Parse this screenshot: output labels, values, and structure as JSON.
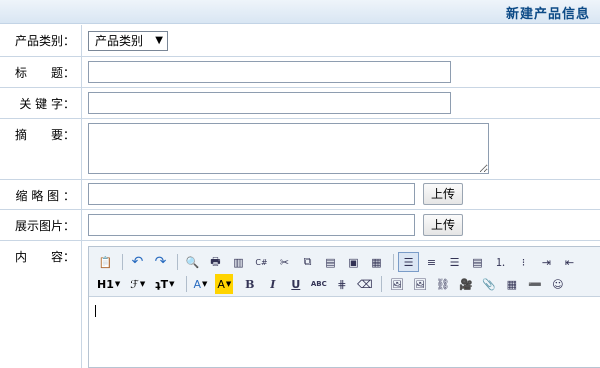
{
  "header": {
    "title": "新建产品信息"
  },
  "form": {
    "category": {
      "label": "产品类别：",
      "selected": "产品类别"
    },
    "title": {
      "label": "标　　题：",
      "value": ""
    },
    "keywords": {
      "label": "关 键 字：",
      "value": ""
    },
    "summary": {
      "label": "摘　　要：",
      "value": ""
    },
    "thumbnail": {
      "label": "缩 略 图 ：",
      "value": "",
      "upload_label": "上传"
    },
    "display_image": {
      "label": "展示图片：",
      "value": "",
      "upload_label": "上传"
    },
    "content": {
      "label": "内　　容："
    }
  },
  "toolbar": {
    "row1_icons": [
      "paste-icon",
      "undo-icon",
      "redo-icon",
      "preview-icon",
      "print-icon",
      "template-icon",
      "code-icon",
      "cut-icon",
      "copy-icon",
      "paste-text-icon",
      "paste-word-icon",
      "paste-plain-icon",
      "align-left-icon",
      "align-center-icon",
      "align-right-icon",
      "justify-icon",
      "ordered-list-icon",
      "unordered-list-icon",
      "indent-icon",
      "outdent-icon"
    ],
    "heading": "H1",
    "font": "ℱ",
    "size": "ʇT",
    "font_color": "A",
    "highlight": "A",
    "bold": "B",
    "italic": "I",
    "underline": "U",
    "strike": "ABC"
  },
  "colors": {
    "accent": "#0c4a86",
    "border": "#c9d6e4",
    "highlight": "#ffd400"
  }
}
